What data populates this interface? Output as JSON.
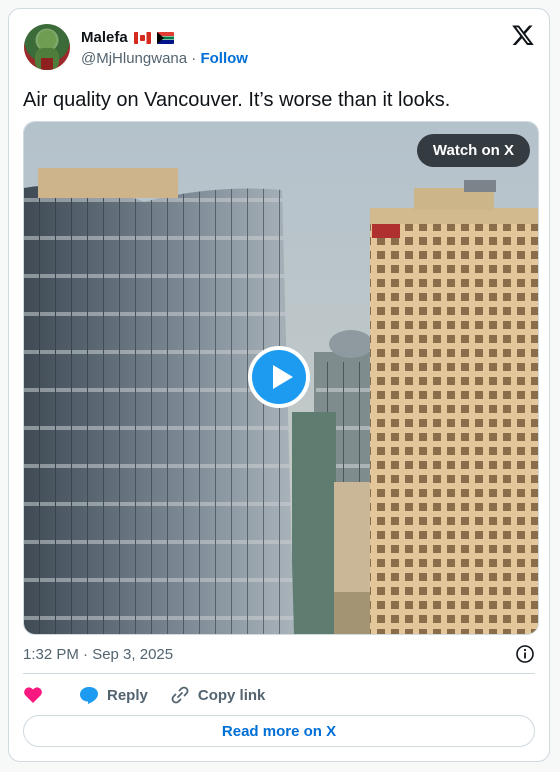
{
  "author": {
    "name": "Malefa",
    "handle": "@MjHlungwana",
    "separator": "·",
    "follow_label": "Follow"
  },
  "tweet": {
    "text": "Air quality on Vancouver. It’s worse than it looks.",
    "timestamp": "1:32 PM · Sep 3, 2025"
  },
  "media": {
    "watch_label": "Watch on X"
  },
  "actions": {
    "reply_label": "Reply",
    "copy_label": "Copy link"
  },
  "footer": {
    "read_more_label": "Read more on X"
  },
  "colors": {
    "accent": "#006fd6",
    "play": "#1d9bf0",
    "heart": "#f91880",
    "muted": "#536471",
    "border": "#cfd9de"
  },
  "icons": [
    "x-logo-icon",
    "play-icon",
    "info-icon",
    "heart-icon",
    "reply-icon",
    "link-icon"
  ]
}
